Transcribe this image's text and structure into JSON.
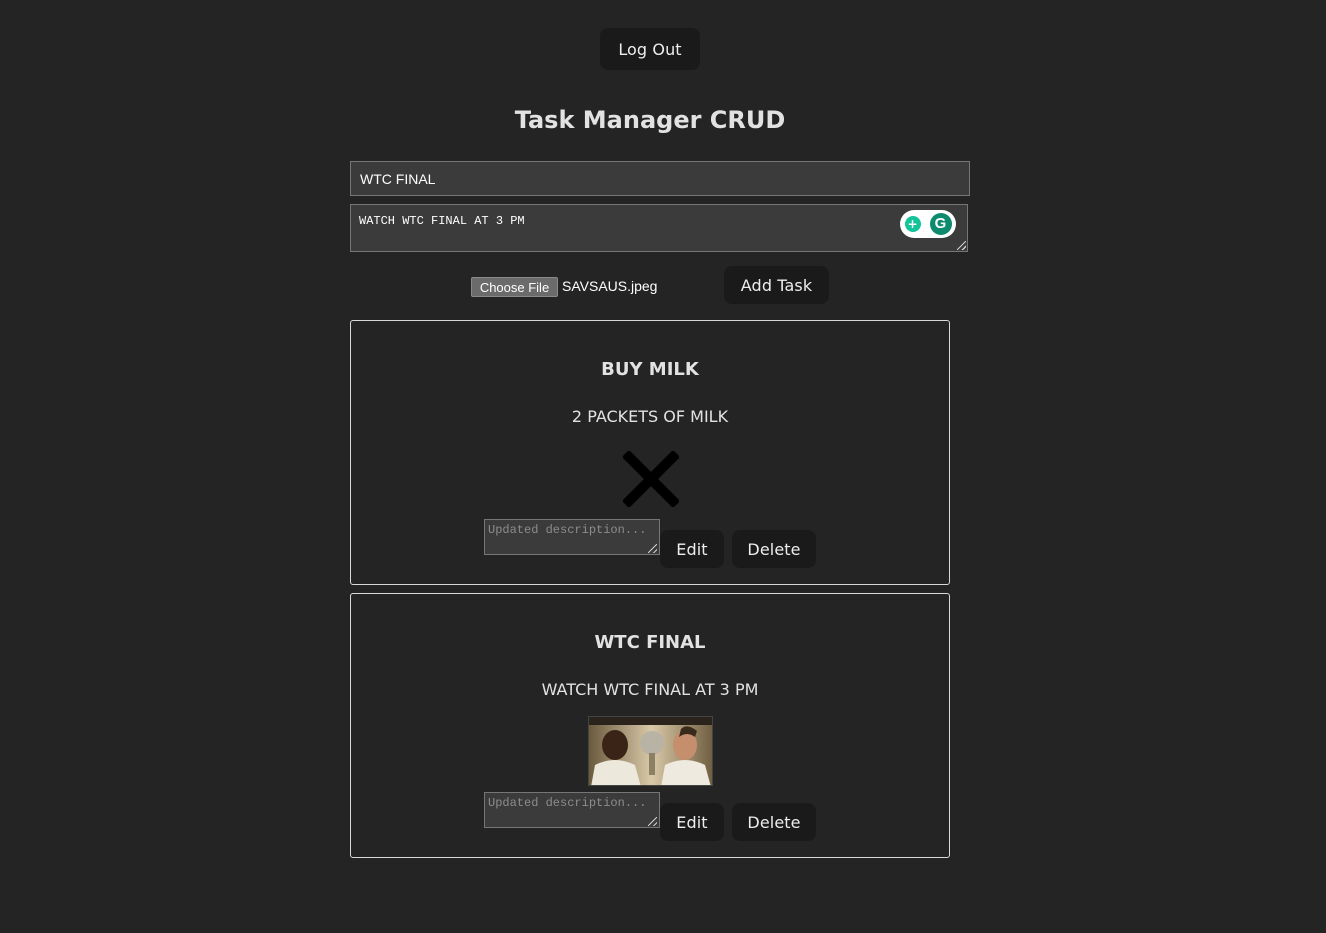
{
  "header": {
    "logout_label": "Log Out",
    "title": "Task Manager CRUD"
  },
  "form": {
    "title_value": "WTC FINAL",
    "description_value": "WATCH WTC FINAL AT 3 PM",
    "file_button_label": "Choose File",
    "file_name": "SAVSAUS.jpeg",
    "add_label": "Add Task"
  },
  "tasks": [
    {
      "title": "BUY MILK",
      "description": "2 PACKETS OF MILK",
      "image": "broken-image-icon",
      "update_placeholder": "Updated description...",
      "edit_label": "Edit",
      "delete_label": "Delete"
    },
    {
      "title": "WTC FINAL",
      "description": "WATCH WTC FINAL AT 3 PM",
      "image": "task-photo",
      "update_placeholder": "Updated description...",
      "edit_label": "Edit",
      "delete_label": "Delete"
    }
  ],
  "colors": {
    "background": "#242424",
    "button": "#1a1a1a",
    "input": "#3b3b3b",
    "card_border": "#d9d9d9",
    "grammarly": "#15c39a"
  }
}
